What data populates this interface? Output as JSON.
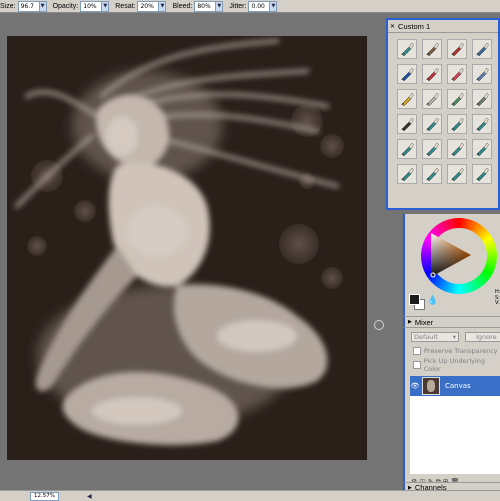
{
  "property_bar": {
    "size": {
      "label": "Size:",
      "value": "96.7"
    },
    "opacity": {
      "label": "Opacity:",
      "value": "10%"
    },
    "resat": {
      "label": "Resat:",
      "value": "20%"
    },
    "bleed": {
      "label": "Bleed:",
      "value": "80%"
    },
    "jitter": {
      "label": "Jitter:",
      "value": "0.00"
    },
    "spinner_glyph": "▼"
  },
  "custom_palette": {
    "title": "Custom 1",
    "close_glyph": "✕",
    "brush_colors": [
      "#2e8a8a",
      "#7a5a3a",
      "#b0302a",
      "#3a6a9a",
      "#1d4ea0",
      "#c0303a",
      "#d04050",
      "#5a7ab0",
      "#d0a020",
      "#b0b0b0",
      "#4a8a5a",
      "#6a7a6a",
      "#303030",
      "#2e8a8a",
      "#2e8a8a",
      "#2e8a8a",
      "#2e8a8a",
      "#2e8a8a",
      "#2e8a8a",
      "#2e8a8a",
      "#2e8a8a",
      "#2e8a8a",
      "#2e8a8a",
      "#2e8a8a"
    ]
  },
  "color_panel": {
    "hsv_labels": [
      "H:",
      "S:",
      "V:"
    ],
    "main_color": "#1c1c1c",
    "additional_color": "#ffffff",
    "dropper_glyph": "💧"
  },
  "mixer": {
    "label": "Mixer",
    "arrow": "▶"
  },
  "layers": {
    "composite_method": "Default",
    "ignore_label": "Ignore",
    "preserve_transparency": "Preserve Transparency",
    "pick_up_underlying": "Pick Up Underlying Color",
    "layer_name": "Canvas",
    "eye_glyph": "👁",
    "toolbar_glyphs": [
      "⚙",
      "◫",
      "✎",
      "⧉",
      "⊞",
      "🗑"
    ]
  },
  "channels": {
    "label": "Channels",
    "arrow": "▶"
  },
  "status_bar": {
    "zoom": "12.57%",
    "scroll_left": "◀"
  }
}
